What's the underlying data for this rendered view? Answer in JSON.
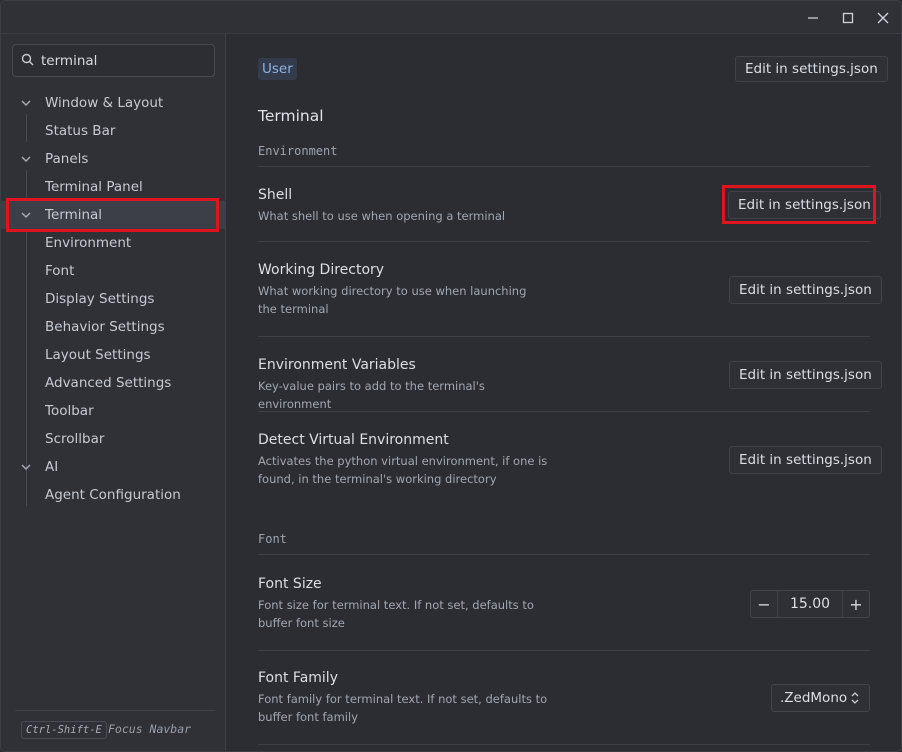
{
  "window_controls": {
    "minimize": "minimize-icon",
    "maximize": "maximize-icon",
    "close": "close-icon"
  },
  "sidebar": {
    "search": {
      "value": "terminal",
      "icon": "search-icon"
    },
    "items": [
      {
        "label": "Window & Layout",
        "expandable": true
      },
      {
        "label": "Status Bar"
      },
      {
        "label": "Panels",
        "expandable": true
      },
      {
        "label": "Terminal Panel"
      },
      {
        "label": "Terminal",
        "expandable": true,
        "selected": true
      },
      {
        "label": "Environment"
      },
      {
        "label": "Font"
      },
      {
        "label": "Display Settings"
      },
      {
        "label": "Behavior Settings"
      },
      {
        "label": "Layout Settings"
      },
      {
        "label": "Advanced Settings"
      },
      {
        "label": "Toolbar"
      },
      {
        "label": "Scrollbar"
      },
      {
        "label": "AI",
        "expandable": true
      },
      {
        "label": "Agent Configuration"
      }
    ],
    "footer": {
      "shortcut": "Ctrl-Shift-E",
      "label": "Focus Navbar"
    }
  },
  "main": {
    "scope_tag": "User",
    "header_button": "Edit in settings.json",
    "section_title": "Terminal",
    "groups": {
      "environment": "Environment",
      "font": "Font"
    },
    "rows": [
      {
        "title": "Shell",
        "description": "What shell to use when opening a terminal",
        "button": "Edit in settings.json"
      },
      {
        "title": "Working Directory",
        "description": "What working directory to use when launching the terminal",
        "button": "Edit in settings.json"
      },
      {
        "title": "Environment Variables",
        "description": "Key-value pairs to add to the terminal's environment",
        "button": "Edit in settings.json"
      },
      {
        "title": "Detect Virtual Environment",
        "description": "Activates the python virtual environment, if one is found, in the terminal's working directory",
        "button": "Edit in settings.json"
      }
    ],
    "font_size": {
      "title": "Font Size",
      "description": "Font size for terminal text. If not set, defaults to buffer font size",
      "value": "15.00",
      "decrement": "−",
      "increment": "+"
    },
    "font_family": {
      "title": "Font Family",
      "description": "Font family for terminal text. If not set, defaults to buffer font family",
      "value": ".ZedMono"
    }
  },
  "colors": {
    "accent_highlight": "#e0141e",
    "tag_text": "#8fb1e3"
  }
}
